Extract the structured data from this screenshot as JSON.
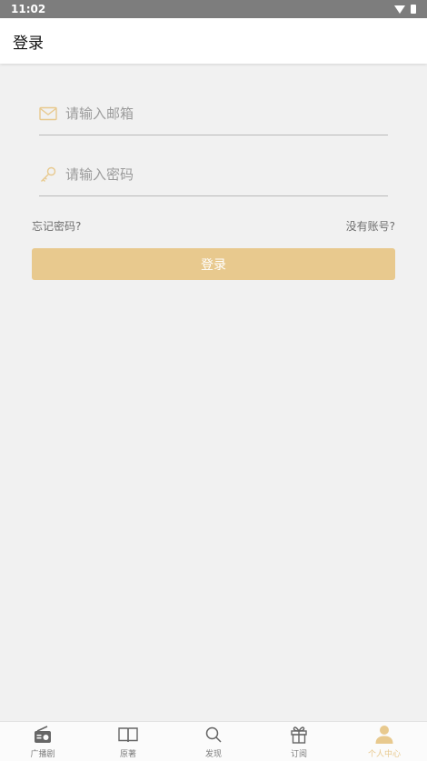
{
  "status_bar": {
    "time": "11:02"
  },
  "app_bar": {
    "title": "登录"
  },
  "form": {
    "email_placeholder": "请输入邮箱",
    "password_placeholder": "请输入密码",
    "forgot_password": "忘记密码?",
    "no_account": "没有账号?",
    "login_button": "登录"
  },
  "bottom_nav": {
    "items": [
      {
        "label": "广播剧",
        "icon": "radio-icon",
        "active": false
      },
      {
        "label": "原著",
        "icon": "book-icon",
        "active": false
      },
      {
        "label": "发现",
        "icon": "search-icon",
        "active": false
      },
      {
        "label": "订阅",
        "icon": "gift-icon",
        "active": false
      },
      {
        "label": "个人中心",
        "icon": "person-icon",
        "active": true
      }
    ]
  },
  "colors": {
    "accent": "#e8c98e",
    "background": "#f1f1f1",
    "status_bar": "#7d7d7d"
  }
}
